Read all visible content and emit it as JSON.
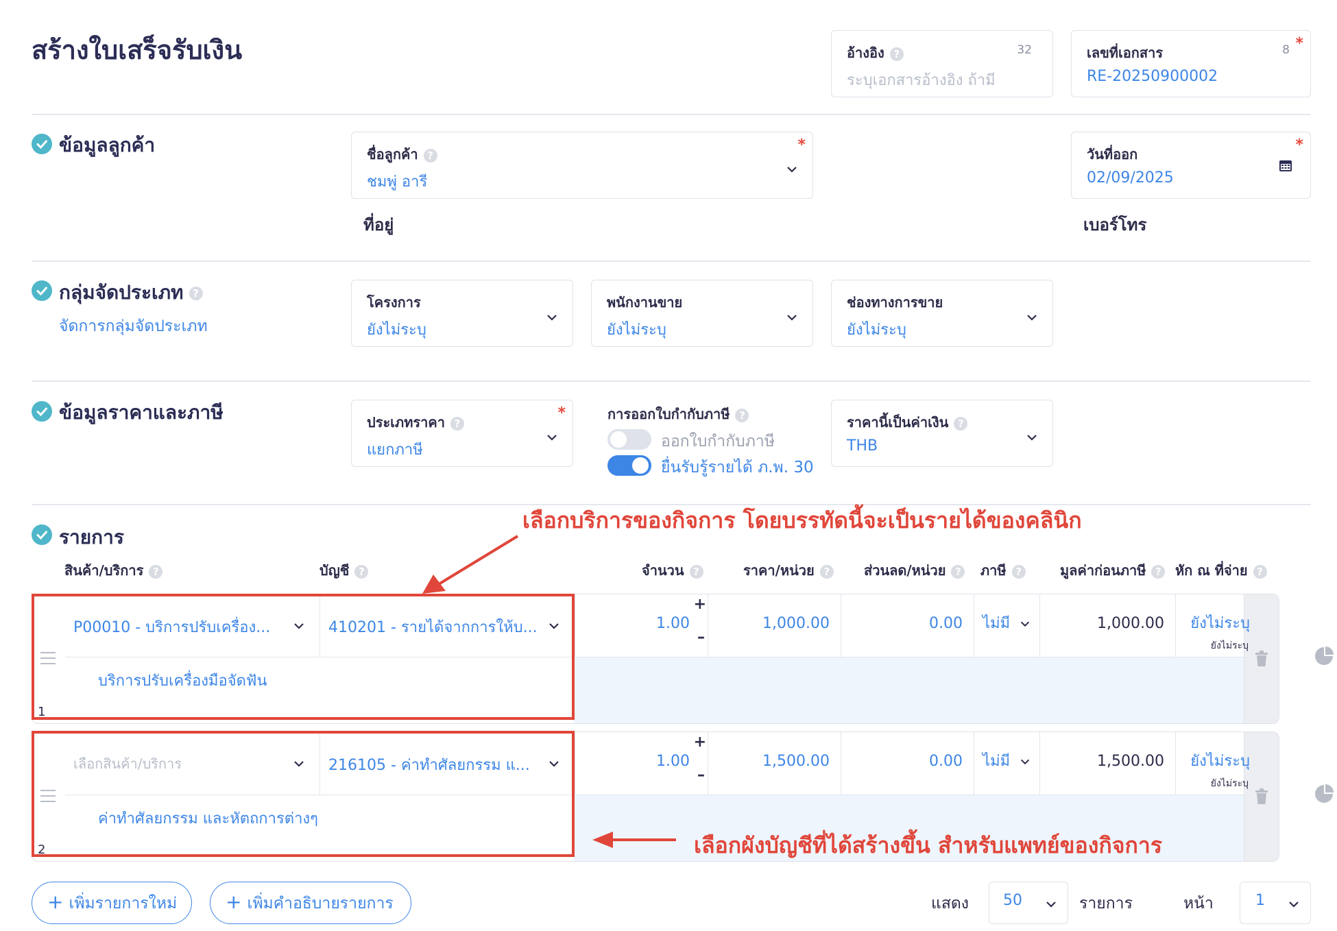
{
  "page": {
    "title": "สร้างใบเสร็จรับเงิน"
  },
  "header": {
    "reference": {
      "label": "อ้างอิง",
      "placeholder": "ระบุเอกสารอ้างอิง ถ้ามี",
      "count": "32"
    },
    "doc_number": {
      "label": "เลขที่เอกสาร",
      "value": "RE-20250900002",
      "count": "8",
      "required": "*"
    }
  },
  "customer_section": {
    "title": "ข้อมูลลูกค้า",
    "customer": {
      "label": "ชื่อลูกค้า",
      "value": "ชมพู่ อารี",
      "required": "*"
    },
    "address_label": "ที่อยู่",
    "date": {
      "label": "วันที่ออก",
      "value": "02/09/2025",
      "required": "*"
    },
    "phone_label": "เบอร์โทร"
  },
  "group_section": {
    "title": "กลุ่มจัดประเภท",
    "manage_link": "จัดการกลุ่มจัดประเภท",
    "project": {
      "label": "โครงการ",
      "value": "ยังไม่ระบุ"
    },
    "salesperson": {
      "label": "พนักงานขาย",
      "value": "ยังไม่ระบุ"
    },
    "channel": {
      "label": "ช่องทางการขาย",
      "value": "ยังไม่ระบุ"
    }
  },
  "price_section": {
    "title": "ข้อมูลราคาและภาษี",
    "price_type": {
      "label": "ประเภทราคา",
      "value": "แยกภาษี",
      "required": "*"
    },
    "tax_invoice": {
      "label": "การออกใบกำกับภาษี",
      "toggle1": "ออกใบกำกับภาษี",
      "toggle2": "ยื่นรับรู้รายได้ ภ.พ. 30",
      "toggle1_on": false,
      "toggle2_on": true
    },
    "currency": {
      "label": "ราคานี้เป็นค่าเงิน",
      "value": "THB"
    }
  },
  "items_section": {
    "title": "รายการ",
    "columns": [
      "สินค้า/บริการ",
      "บัญชี",
      "จำนวน",
      "ราคา/หน่วย",
      "ส่วนลด/หน่วย",
      "ภาษี",
      "มูลค่าก่อนภาษี",
      "หัก ณ ที่จ่าย"
    ],
    "rows": [
      {
        "num": "1",
        "product": "P00010 - บริการปรับเครื่อง...",
        "product_placeholder": false,
        "account": "410201 - รายได้จากการให้บ...",
        "qty": "1.00",
        "price": "1,000.00",
        "discount": "0.00",
        "tax": "ไม่มี",
        "amount": "1,000.00",
        "wht": "ยังไม่ระบุ",
        "wht_sub": "ยังไม่ระบุ",
        "description": "บริการปรับเครื่องมือจัดฟัน"
      },
      {
        "num": "2",
        "product": "เลือกสินค้า/บริการ",
        "product_placeholder": true,
        "account": "216105 - ค่าทำศัลยกรรม แ...",
        "qty": "1.00",
        "price": "1,500.00",
        "discount": "0.00",
        "tax": "ไม่มี",
        "amount": "1,500.00",
        "wht": "ยังไม่ระบุ",
        "wht_sub": "ยังไม่ระบุ",
        "description": "ค่าทำศัลยกรรม และหัตถการต่างๆ"
      }
    ],
    "add_item": "เพิ่มรายการใหม่",
    "add_desc": "เพิ่มคำอธิบายรายการ",
    "show_label": "แสดง",
    "per_page": "50",
    "items_label": "รายการ",
    "page_label": "หน้า",
    "page": "1"
  },
  "annotations": {
    "top": "เลือกบริการของกิจการ โดยบรรทัดนี้จะเป็นรายได้ของคลินิก",
    "bottom": "เลือกผังบัญชีที่ได้สร้างขึ้น สำหรับแพทย์ของกิจการ"
  },
  "colors": {
    "accent": "#3d86e6",
    "annotation": "#e0463a",
    "check": "#4fb7c9"
  }
}
